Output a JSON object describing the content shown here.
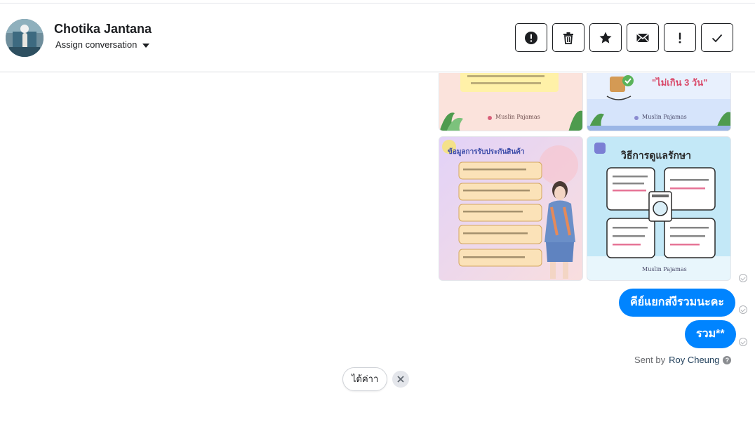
{
  "header": {
    "contact_name": "Chotika Jantana",
    "assign_label": "Assign conversation",
    "actions": [
      {
        "icon": "alert-circle-icon",
        "name": "spam-button"
      },
      {
        "icon": "trash-icon",
        "name": "delete-button"
      },
      {
        "icon": "star-icon",
        "name": "star-button"
      },
      {
        "icon": "envelope-icon",
        "name": "mark-unread-button"
      },
      {
        "icon": "exclamation-icon",
        "name": "follow-up-button"
      },
      {
        "icon": "checkmark-icon",
        "name": "mark-done-button"
      }
    ]
  },
  "images": {
    "top_left": {
      "brand": "Muslin Pajamas"
    },
    "top_right": {
      "headline": "\"ไม่เกิน 3 วัน\"",
      "brand": "Muslin Pajamas"
    },
    "bottom_left": {
      "title": "ข้อมูลการรับประกันสินค้า"
    },
    "bottom_right": {
      "title": "วิธีการดูแลรักษา",
      "brand": "Muslin Pajamas"
    }
  },
  "messages": [
    {
      "text": "คีย์แยกส่งีรวมนะคะ"
    },
    {
      "text": "รวม**"
    }
  ],
  "sent_by": {
    "prefix": "Sent by",
    "author": "Roy Cheung"
  },
  "quick_reply": {
    "label": "ได้ค่าา"
  },
  "colors": {
    "bubble": "#0084ff",
    "tile_tl_bg": "#fde6e0",
    "tile_tr_bg": "#dbe7fb",
    "tile_bl_bg": "#e9d9f6",
    "tile_br_bg": "#bfe6f6"
  }
}
